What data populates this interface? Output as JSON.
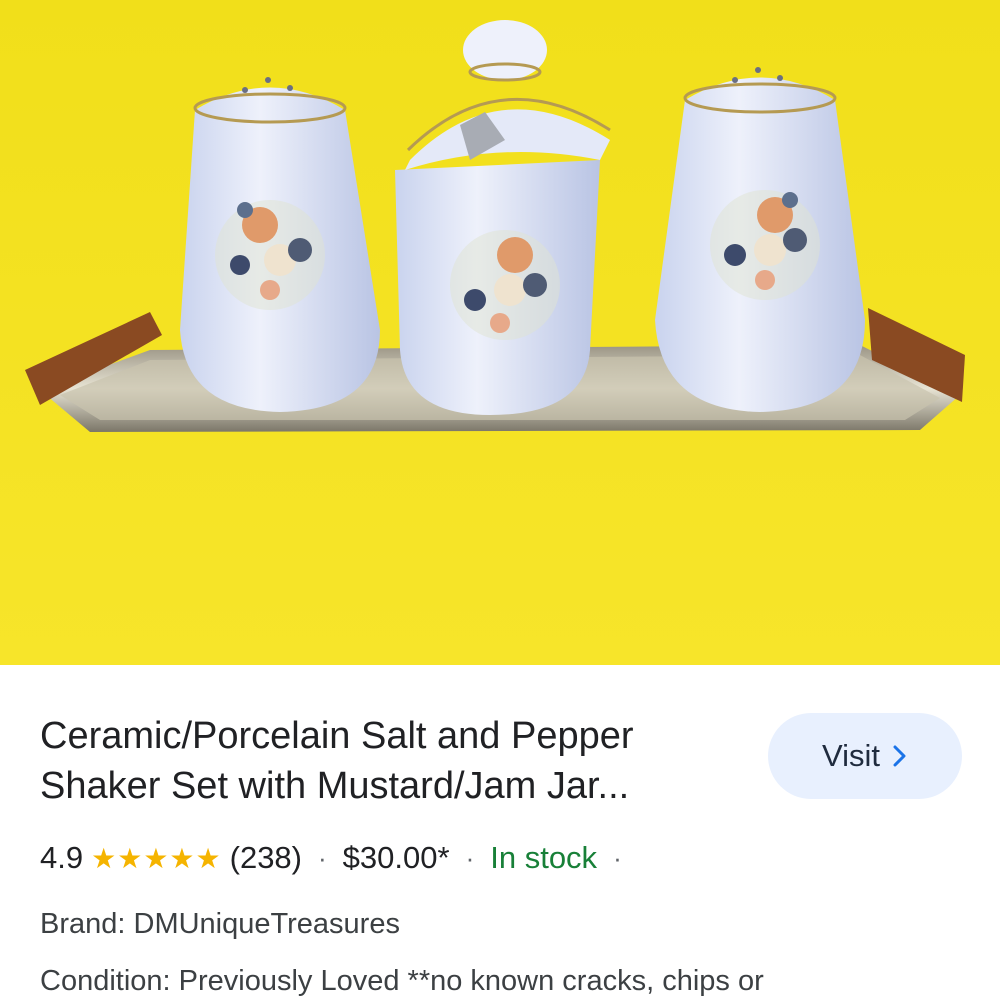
{
  "product": {
    "title_line1": "Ceramic/Porcelain Salt and Pepper",
    "title_line2": "Shaker Set with Mustard/Jam Jar...",
    "rating": "4.9",
    "stars": "★★★★★",
    "review_count": "(238)",
    "price": "$30.00*",
    "stock_status": "In stock",
    "brand": "Brand: DMUniqueTreasures",
    "condition": "Condition: Previously Loved **no known cracks, chips or"
  },
  "visit_button": {
    "label": "Visit",
    "icon": "chevron-right-icon"
  },
  "separator": "·",
  "colors": {
    "photo_background": "#f4e21e",
    "visit_bg": "#e8f0fe",
    "in_stock": "#188038",
    "star": "#f5b400"
  }
}
